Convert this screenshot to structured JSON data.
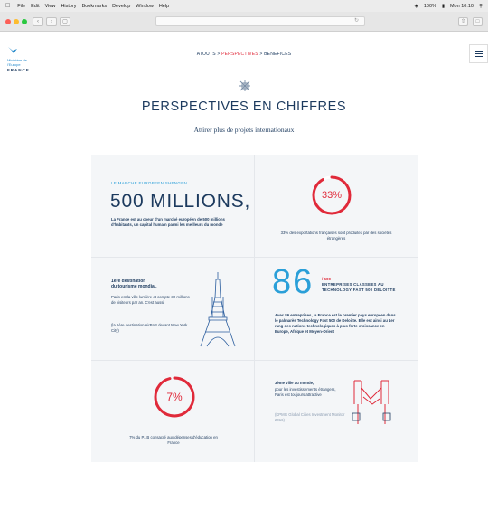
{
  "menubar": {
    "items": [
      "File",
      "Edit",
      "View",
      "History",
      "Bookmarks",
      "Develop",
      "Window",
      "Help"
    ],
    "battery": "100%",
    "clock": "Mon 10:10"
  },
  "page": {
    "logo": {
      "line1": "Ministère de",
      "line2": "l'Europe",
      "line3": "FRANCE"
    },
    "breadcrumb": {
      "part1": "ATOUTS",
      "sep": " > ",
      "part2": "PERSPECTIVES",
      "part3": "BENEFICES"
    },
    "title": "PERSPECTIVES EN CHIFFRES",
    "subtitle": "Attirer plus de projets internationaux"
  },
  "cells": {
    "market": {
      "label": "LE MARCHE EUROPEEN SHENGEN",
      "big": "500 MILLIONS,",
      "text": "La France est au coeur d'un marché européen de 500 millions d'habitants, un capital humain parmi les meilleurs du monde"
    },
    "exports": {
      "percent": "33%",
      "percent_value": 33,
      "text": "33% des exportations françaises sont produites par des sociétés étrangères"
    },
    "tourism": {
      "heading1": "1ère destination",
      "heading2": "du tourisme mondial,",
      "text1": "Paris est la ville lumière et compte 30 millions de visiteurs par an. C'est aussi",
      "text2": "(la 1ère destination AirBnB devant New York City)"
    },
    "deloitte": {
      "big": "86",
      "over": "/ 500",
      "label": "ENTREPRISES CLASSEES AU TECHNOLOGY FAST 500 DELOITTE",
      "text": "Avec 86 entreprises, la France est le premier pays européen dans le palmarès Technology Fast 500 de Deloitte. Elle est ainsi au 1er rang des nations technologiques à plus forte croissance en Europe, Afrique et Moyen-Orient"
    },
    "education": {
      "percent": "7%",
      "percent_value": 7,
      "text": "7% du P.I.B consacré aux dépenses d'éducation en France"
    },
    "investment": {
      "heading": "3ème ville au monde,",
      "text": "pour les investissements étrangers, Paris est toujours attractive",
      "source": "(KPMG Global Cities Investment Monitor 2016)"
    }
  }
}
